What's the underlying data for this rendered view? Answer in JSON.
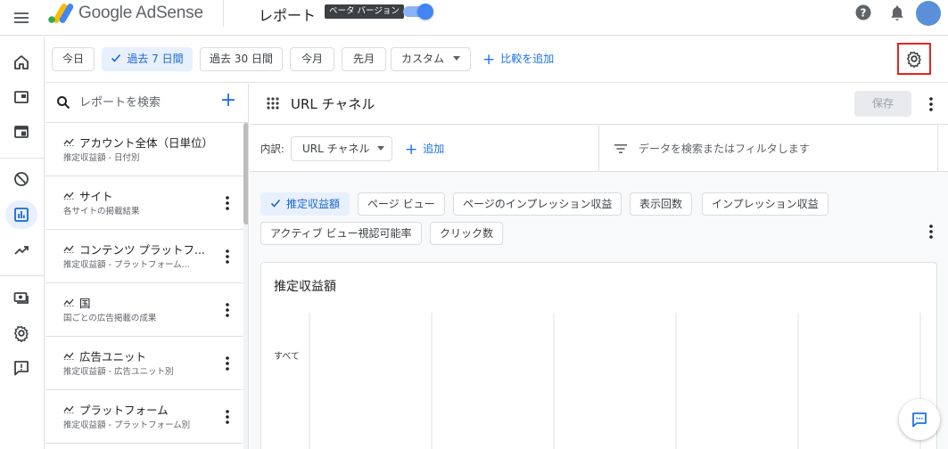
{
  "topbar": {
    "brand": "Google AdSense",
    "page_name": "レポート",
    "beta_label": "ベータ バージョン",
    "beta_enabled": true,
    "icons": [
      "menu-icon",
      "adsense-logo",
      "help-icon",
      "notifications-icon",
      "account-avatar"
    ]
  },
  "rail": {
    "items": [
      {
        "icon": "home-icon"
      },
      {
        "icon": "ads-icon"
      },
      {
        "icon": "sites-icon"
      },
      {
        "icon": "blocking-controls-icon"
      },
      {
        "icon": "reports-icon",
        "active": true
      },
      {
        "icon": "optimization-icon"
      },
      {
        "icon": "payments-icon"
      },
      {
        "icon": "settings-icon"
      },
      {
        "icon": "feedback-icon"
      }
    ]
  },
  "datebar": {
    "ranges": [
      "今日",
      "過去 7 日間",
      "過去 30 日間",
      "今月",
      "先月"
    ],
    "selected_range": "過去 7 日間",
    "custom_label": "カスタム",
    "add_compare": "比較を追加",
    "settings_icon": "settings-icon"
  },
  "reports": {
    "search_placeholder": "レポートを検索",
    "items": [
      {
        "title": "アカウント全体（日単位）",
        "subtitle": "推定収益額 - 日付別"
      },
      {
        "title": "サイト",
        "subtitle": "各サイトの掲載結果"
      },
      {
        "title": "コンテンツ プラットフ...",
        "subtitle": "推定収益額 - プラットフォーム..."
      },
      {
        "title": "国",
        "subtitle": "国ごとの広告掲載の成果"
      },
      {
        "title": "広告ユニット",
        "subtitle": "推定収益額 - 広告ユニット別"
      },
      {
        "title": "プラットフォーム",
        "subtitle": "推定収益額 - プラットフォーム別"
      }
    ]
  },
  "main": {
    "report_title": "URL チャネル",
    "save_label": "保存",
    "breakdown_label": "内訳:",
    "dimension": "URL チャネル",
    "add_dimension": "追加",
    "filter_placeholder": "データを検索またはフィルタします",
    "metrics": [
      {
        "label": "推定収益額",
        "selected": true
      },
      {
        "label": "ページ ビュー",
        "selected": false
      },
      {
        "label": "ページのインプレッション収益",
        "selected": false
      },
      {
        "label": "表示回数",
        "selected": false
      },
      {
        "label": "インプレッション収益",
        "selected": false
      },
      {
        "label": "アクティブ ビュー視認可能率",
        "selected": false
      },
      {
        "label": "クリック数",
        "selected": false
      }
    ],
    "chart_title": "推定収益額",
    "chart_row_label": "すべて"
  },
  "colors": {
    "accent": "#1a73e8",
    "selected_chip_bg": "#e8f0fe",
    "highlight_border": "#e8231f"
  }
}
